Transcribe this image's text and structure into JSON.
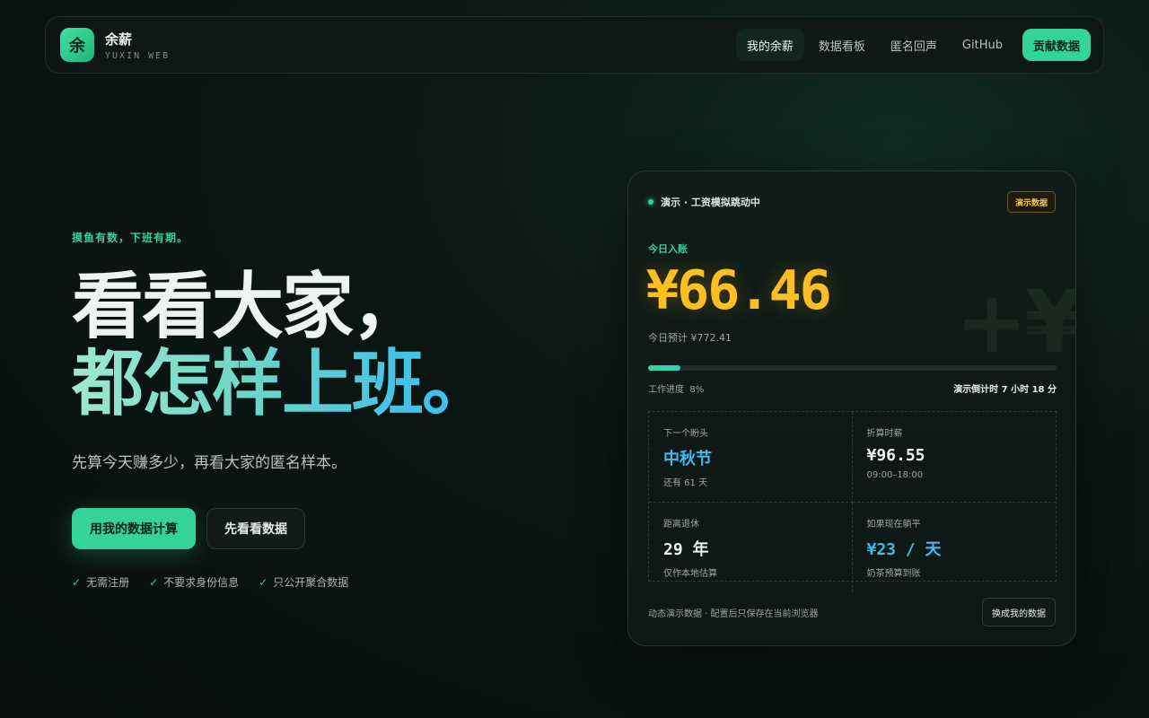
{
  "brand": {
    "logo_char": "余",
    "name": "余薪",
    "subtitle": "YUXIN WEB"
  },
  "nav": {
    "links": [
      {
        "label": "我的余薪",
        "active": true
      },
      {
        "label": "数据看板",
        "active": false
      },
      {
        "label": "匿名回声",
        "active": false
      },
      {
        "label": "GitHub",
        "active": false
      }
    ],
    "cta_label": "贡献数据"
  },
  "hero": {
    "eyebrow": "摸鱼有数，下班有期。",
    "headline_line1": "看看大家，",
    "headline_line2": "都怎样上班。",
    "subtitle": "先算今天赚多少，再看大家的匿名样本。",
    "primary_cta": "用我的数据计算",
    "secondary_cta": "先看看数据",
    "checks": [
      "无需注册",
      "不要求身份信息",
      "只公开聚合数据"
    ]
  },
  "card": {
    "status": "演示 · 工资模拟跳动中",
    "badge": "演示数据",
    "watermark": "+¥",
    "today_label": "今日入账",
    "amount": "¥66.46",
    "forecast": "今日预计 ¥772.41",
    "progress_label": "工作进度",
    "progress_value": "8%",
    "progress_fraction": 0.08,
    "countdown": "演示倒计时 7 小时 18 分",
    "cells": [
      {
        "label": "下一个盼头",
        "value": "中秋节",
        "note": "还有 61 天"
      },
      {
        "label": "折算时薪",
        "value": "¥96.55",
        "note": "09:00–18:00"
      },
      {
        "label": "距离退休",
        "value": "29 年",
        "note": "仅作本地估算"
      },
      {
        "label": "如果现在躺平",
        "value": "¥23 / 天",
        "note": "奶茶预算到账"
      }
    ],
    "footer_note": "动态演示数据 · 配置后只保存在当前浏览器",
    "switch_label": "换成我的数据"
  },
  "colors": {
    "accent": "#34d399",
    "amount": "#fbbf24",
    "highlight_blue": "#3fb9f0",
    "background": "#0b1613"
  }
}
